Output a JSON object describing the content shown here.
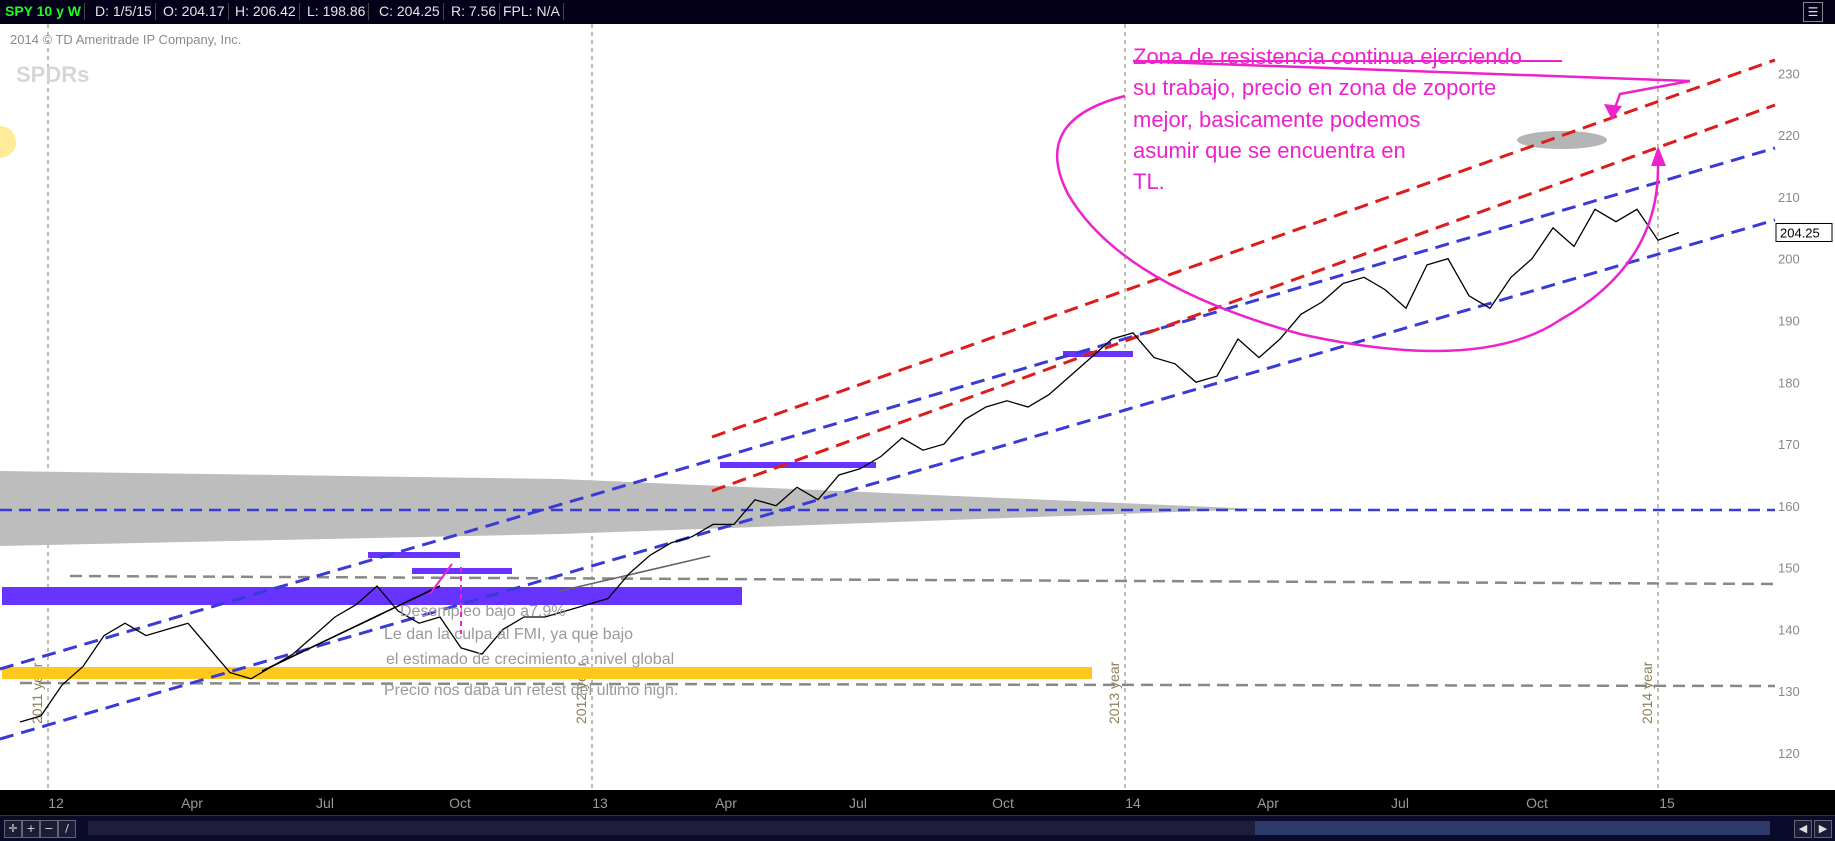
{
  "header": {
    "symbol": "SPY 10 y W",
    "date": "D: 1/5/15",
    "open": "O: 204.17",
    "high": "H: 206.42",
    "low": "L: 198.86",
    "close": "C: 204.25",
    "range": "R: 7.56",
    "fpl": "FPL: N/A",
    "menu_icon": "menu-icon"
  },
  "watermark": {
    "copyright": "2014 © TD Ameritrade IP Company, Inc.",
    "logo_text": "SPDRs"
  },
  "annotation": {
    "lines": [
      "Zona de resistencia continua ejerciendo",
      "su trabajo, precio en zona de zoporte",
      "mejor, basicamente podemos",
      "asumir que se encuentra en",
      "TL."
    ],
    "notes": [
      "Desempleo bajo a7.9%",
      "Le dan la culpa al FMI, ya que bajo",
      "el estimado de crecimiento a nivel global",
      "Precio nos daba un retest del ultimo high."
    ]
  },
  "colors": {
    "background": "#ffffff",
    "price": "#000000",
    "red_channel": "#dd1c1c",
    "blue_line": "#3a3ad6",
    "magenta": "#ee22cc",
    "purple_zone": "#6633ff",
    "yellow_zone": "#ffc81a",
    "gray_zone": "#bdbdbd"
  },
  "chart_data": {
    "type": "line",
    "title": "SPY 10 y W",
    "ylim": [
      114,
      238
    ],
    "y_ticks": [
      120,
      130,
      140,
      150,
      160,
      170,
      180,
      190,
      200,
      210,
      220,
      230
    ],
    "last_price_label": "204.25",
    "x_labels": [
      "12",
      "Apr",
      "Jul",
      "Oct",
      "13",
      "Apr",
      "Jul",
      "Oct",
      "14",
      "Apr",
      "Jul",
      "Oct",
      "15"
    ],
    "year_labels": [
      "2011 year",
      "2012 year",
      "2013 year",
      "2014 year"
    ],
    "series": [
      {
        "x": [
          0,
          2,
          4,
          6,
          8,
          10,
          12,
          14,
          16,
          18,
          20,
          22,
          24,
          26,
          28,
          30,
          32,
          34,
          36,
          38,
          40,
          42,
          44,
          46,
          48,
          50,
          52,
          54,
          56,
          58,
          60,
          62,
          64,
          66,
          68,
          70,
          72,
          74,
          76,
          78,
          80,
          82,
          84,
          86,
          88,
          90,
          92,
          94,
          96,
          98,
          100,
          102,
          104,
          106,
          108,
          110,
          112,
          114,
          116,
          118,
          120,
          122,
          124,
          126,
          128,
          130,
          132,
          134,
          136,
          138,
          140,
          142,
          144,
          146,
          148,
          150,
          152,
          154,
          156,
          158
        ],
        "values": [
          125,
          127,
          130,
          135,
          138,
          140,
          139,
          141,
          140,
          137,
          134,
          132,
          132,
          135,
          138,
          141,
          143,
          147,
          144,
          140,
          142,
          138,
          135,
          141,
          142,
          142,
          143,
          144,
          144,
          148,
          152,
          153,
          155,
          156,
          158,
          160,
          161,
          163,
          162,
          164,
          166,
          169,
          172,
          168,
          170,
          173,
          176,
          178,
          175,
          177,
          180,
          184,
          186,
          188,
          185,
          183,
          181,
          180,
          186,
          183,
          186,
          190,
          193,
          195,
          197,
          196,
          192,
          198,
          200,
          195,
          193,
          196,
          199,
          205,
          203,
          207,
          206,
          209,
          204,
          205
        ],
        "close_values": [
          125,
          126,
          131,
          134,
          139,
          141,
          139,
          140,
          141,
          137,
          133,
          132,
          134,
          136,
          139,
          142,
          144,
          147,
          143,
          141,
          142,
          137,
          136,
          140,
          142,
          142,
          143,
          144,
          145,
          149,
          152,
          154,
          155,
          157,
          157,
          161,
          160,
          163,
          161,
          165,
          166,
          168,
          171,
          169,
          170,
          174,
          176,
          177,
          176,
          178,
          181,
          184,
          187,
          188,
          184,
          183,
          180,
          181,
          187,
          184,
          187,
          191,
          193,
          196,
          197,
          195,
          192,
          199,
          200,
          194,
          192,
          197,
          200,
          205,
          202,
          208,
          206,
          208,
          203,
          204.25
        ]
      }
    ],
    "notes_count": 4
  }
}
